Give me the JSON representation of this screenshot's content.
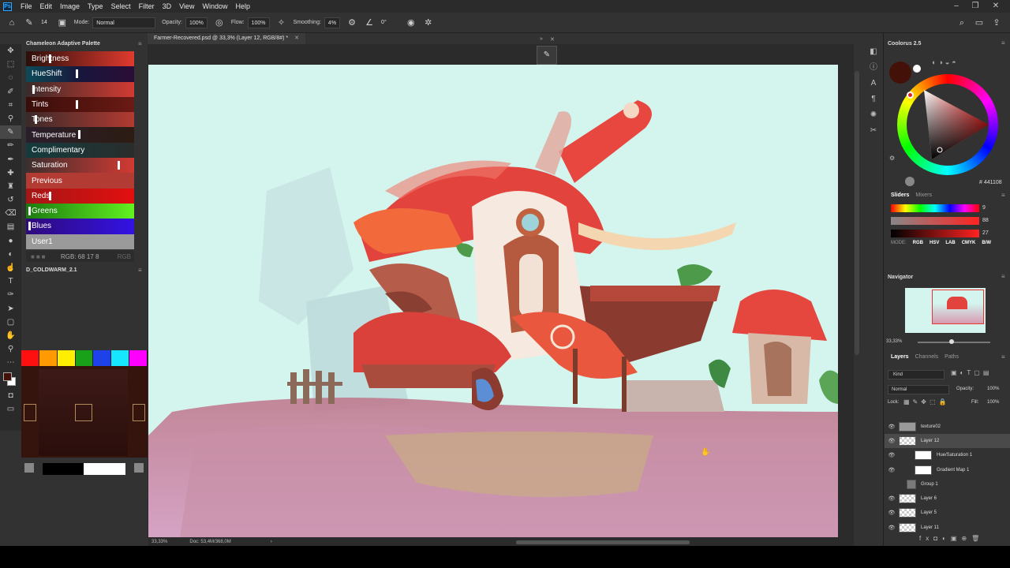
{
  "menubar": {
    "logo": "Ps",
    "items": [
      "File",
      "Edit",
      "Image",
      "Type",
      "Select",
      "Filter",
      "3D",
      "View",
      "Window",
      "Help"
    ]
  },
  "options": {
    "brush_size": "14",
    "mode_label": "Mode:",
    "mode_value": "Normal",
    "opacity_label": "Opacity:",
    "opacity_value": "100%",
    "flow_label": "Flow:",
    "flow_value": "100%",
    "smoothing_label": "Smoothing:",
    "smoothing_value": "4%",
    "angle_value": "0°"
  },
  "document": {
    "tab_title": "Farmer-Recovered.psd @ 33,3% (Layer 12, RGB/8#) *",
    "zoom": "33,33%",
    "doc_size": "Doc: 53,4M/368,0M"
  },
  "chameleon": {
    "title": "Chameleon Adaptive Palette",
    "rows": [
      {
        "label": "Brightness",
        "colors": [
          "#2b0f0b",
          "#e03a2e"
        ],
        "marker": 0.21
      },
      {
        "label": "HueShift",
        "colors": [
          "#0d4b58",
          "#18163c",
          "#2c0d37"
        ],
        "marker": 0.46
      },
      {
        "label": "Intensity",
        "colors": [
          "#3a2b2a",
          "#d13b33"
        ],
        "marker": 0.06
      },
      {
        "label": "Tints",
        "colors": [
          "#3a0d0a",
          "#6b1a14"
        ],
        "marker": 0.46
      },
      {
        "label": "Tones",
        "colors": [
          "#3b2a29",
          "#b23a32"
        ],
        "marker": 0.08
      },
      {
        "label": "Temperature",
        "colors": [
          "#2b1e2c",
          "#2c1c13"
        ],
        "marker": 0.48
      },
      {
        "label": "Complimentary",
        "colors": [
          "#143b3d",
          "#2a2d2c"
        ],
        "marker": null
      },
      {
        "label": "Saturation",
        "colors": [
          "#3c2f2e",
          "#d23a33"
        ],
        "marker": 0.85
      },
      {
        "label": "Previous",
        "colors": [
          "#b23b33",
          "#b23b33"
        ],
        "marker": null
      },
      {
        "label": "Reds",
        "colors": [
          "#a51616",
          "#e30f0f"
        ],
        "marker": 0.21
      },
      {
        "label": "Greens",
        "colors": [
          "#1b7a10",
          "#62f21f"
        ],
        "marker": 0.02
      },
      {
        "label": "Blues",
        "colors": [
          "#2f0a7b",
          "#3313e3"
        ],
        "marker": 0.02
      },
      {
        "label": "User1",
        "colors": [
          "#9a9a9a",
          "#9a9a9a"
        ],
        "marker": null
      }
    ],
    "status": "RGB: 68 17 8",
    "status_right": "RGB"
  },
  "palette_panel": {
    "title": "D_COLDWARM_2.1",
    "swatches": [
      "#ff1010",
      "#ff9a00",
      "#ffee00",
      "#1aa11a",
      "#1f42e8",
      "#17e6ff",
      "#ff00ff"
    ]
  },
  "coolorus": {
    "title": "Coolorus 2.5",
    "hex": "# 441108"
  },
  "sliders": {
    "tabs": [
      "Sliders",
      "Mixers"
    ],
    "values": [
      "9",
      "88",
      "27"
    ],
    "modes": [
      "MODE:",
      "RGB",
      "HSV",
      "LAB",
      "CMYK",
      "B/W"
    ]
  },
  "navigator": {
    "title": "Navigator",
    "zoom": "33,33%"
  },
  "layers": {
    "tabs": [
      "Layers",
      "Channels",
      "Paths"
    ],
    "kind": "Kind",
    "blend": "Normal",
    "opacity_label": "Opacity:",
    "opacity": "100%",
    "lock_label": "Lock:",
    "fill_label": "Fill:",
    "fill": "100%",
    "items": [
      {
        "name": "texture02",
        "selected": false
      },
      {
        "name": "Layer 12",
        "selected": true
      },
      {
        "name": "Hue/Saturation 1",
        "selected": false
      },
      {
        "name": "Gradient Map 1",
        "selected": false
      },
      {
        "name": "Group 1",
        "selected": false
      },
      {
        "name": "Layer 6",
        "selected": false
      },
      {
        "name": "Layer 5",
        "selected": false
      },
      {
        "name": "Layer 11",
        "selected": false
      }
    ]
  },
  "colors": {
    "foreground": "#441108",
    "background": "#ffffff",
    "canvas_bg": "#d4f4ee"
  }
}
